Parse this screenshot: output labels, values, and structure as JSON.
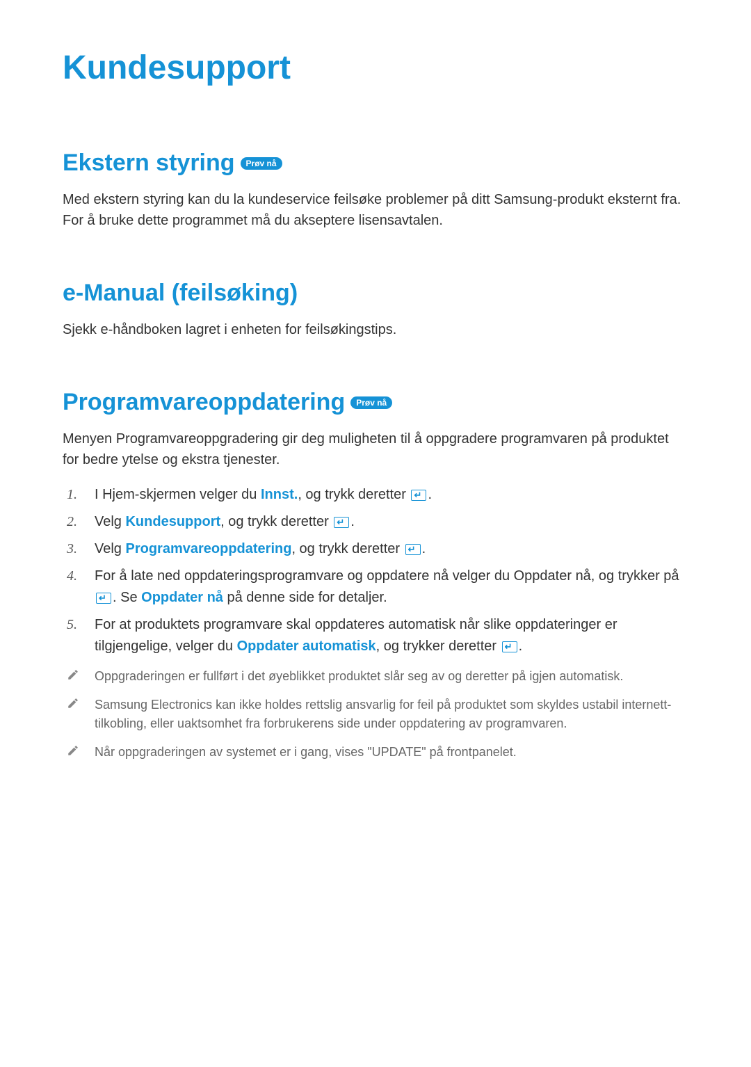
{
  "title": "Kundesupport",
  "badge_label": "Prøv nå",
  "sections": {
    "remote": {
      "heading": "Ekstern styring",
      "has_badge": true,
      "body": "Med ekstern styring kan du la kundeservice feilsøke problemer på ditt Samsung-produkt eksternt fra. For å bruke dette programmet må du akseptere lisensavtalen."
    },
    "emanual": {
      "heading": "e-Manual (feilsøking)",
      "has_badge": false,
      "body": "Sjekk e-håndboken lagret i enheten for feilsøkingstips."
    },
    "update": {
      "heading": "Programvareoppdatering",
      "has_badge": true,
      "intro": "Menyen Programvareoppgradering gir deg muligheten til å oppgradere programvaren på produktet for bedre ytelse og ekstra tjenester.",
      "steps": [
        {
          "pre": "I Hjem-skjermen velger du ",
          "hl": "Innst.",
          "mid": ", og trykk deretter ",
          "icon": true,
          "post": "."
        },
        {
          "pre": "Velg ",
          "hl": "Kundesupport",
          "mid": ", og trykk deretter ",
          "icon": true,
          "post": "."
        },
        {
          "pre": "Velg ",
          "hl": "Programvareoppdatering",
          "mid": ", og trykk deretter ",
          "icon": true,
          "post": "."
        },
        {
          "pre": "For å late ned oppdateringsprogramvare og oppdatere nå velger du Oppdater nå, og trykker på ",
          "icon_first": true,
          "mid2": ". Se ",
          "hl": "Oppdater nå",
          "post": " på denne side for detaljer."
        },
        {
          "pre": "For at produktets programvare skal oppdateres automatisk når slike oppdateringer er tilgjengelige, velger du ",
          "hl": "Oppdater automatisk",
          "mid": ", og trykker deretter ",
          "icon": true,
          "post": "."
        }
      ],
      "notes": [
        "Oppgraderingen er fullført i det øyeblikket produktet slår seg av og deretter på igjen automatisk.",
        "Samsung Electronics kan ikke holdes rettslig ansvarlig for feil på produktet som skyldes ustabil internett-tilkobling, eller uaktsomhet fra forbrukerens side under oppdatering av programvaren.",
        "Når oppgraderingen av systemet er i gang, vises \"UPDATE\" på frontpanelet."
      ]
    }
  }
}
